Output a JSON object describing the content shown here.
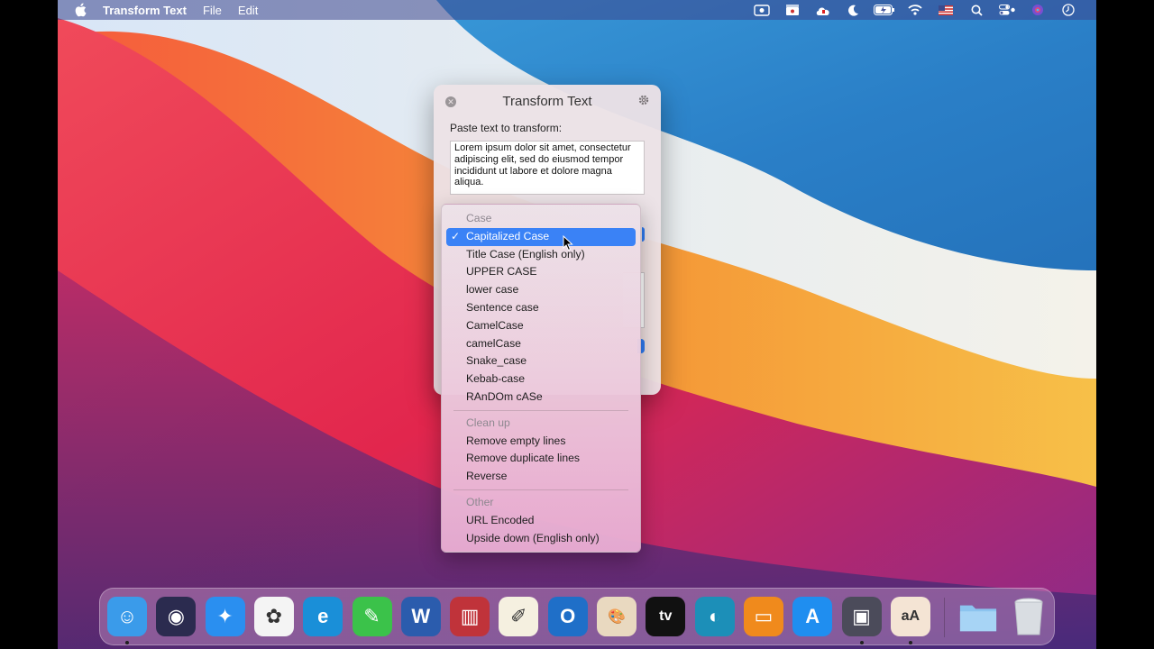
{
  "menubar": {
    "app_name": "Transform Text",
    "menus": [
      "File",
      "Edit"
    ],
    "status_icons": [
      "screen-record-icon",
      "clapper-icon",
      "cloud-icon",
      "moon-icon",
      "battery-icon",
      "wifi-icon",
      "flag-icon",
      "search-icon",
      "control-center-icon",
      "siri-icon",
      "clock-icon"
    ]
  },
  "window": {
    "title": "Transform Text",
    "input_label": "Paste text to transform:",
    "input_text": "Lorem ipsum dolor sit amet, consectetur adipiscing elit, sed do eiusmod tempor incididunt ut labore et dolore magna aliqua."
  },
  "dropdown": {
    "sections": [
      {
        "header": "Case",
        "items": [
          {
            "label": "Capitalized Case",
            "selected": true
          },
          {
            "label": "Title Case (English only)"
          },
          {
            "label": "UPPER CASE"
          },
          {
            "label": "lower case"
          },
          {
            "label": "Sentence case"
          },
          {
            "label": "CamelCase"
          },
          {
            "label": "camelCase"
          },
          {
            "label": "Snake_case"
          },
          {
            "label": "Kebab-case"
          },
          {
            "label": "RAnDOm cASe"
          }
        ]
      },
      {
        "header": "Clean up",
        "items": [
          {
            "label": "Remove empty lines"
          },
          {
            "label": "Remove duplicate lines"
          },
          {
            "label": "Reverse"
          }
        ]
      },
      {
        "header": "Other",
        "items": [
          {
            "label": "URL Encoded"
          },
          {
            "label": "Upside down (English only)"
          }
        ]
      }
    ],
    "check_glyph": "✓"
  },
  "dock": {
    "apps": [
      {
        "name": "finder-icon",
        "color": "#3a9bea",
        "glyph": "☺",
        "running": true
      },
      {
        "name": "siri-icon",
        "color": "#2b2b4f",
        "glyph": "◉",
        "running": false
      },
      {
        "name": "safari-icon",
        "color": "#2a8ff0",
        "glyph": "✦",
        "running": false
      },
      {
        "name": "photos-icon",
        "color": "#f4f4f4",
        "glyph": "✿",
        "running": false
      },
      {
        "name": "internet-explorer-icon",
        "color": "#1a8fd8",
        "glyph": "e",
        "running": false
      },
      {
        "name": "evernote-icon",
        "color": "#3bc24a",
        "glyph": "✎",
        "running": false
      },
      {
        "name": "word-icon",
        "color": "#2b5cad",
        "glyph": "W",
        "running": false
      },
      {
        "name": "parallels-icon",
        "color": "#c0333a",
        "glyph": "▥",
        "running": false
      },
      {
        "name": "textedit-icon",
        "color": "#f5f0e0",
        "glyph": "✐",
        "running": false
      },
      {
        "name": "outlook-icon",
        "color": "#1f6fc8",
        "glyph": "O",
        "running": false
      },
      {
        "name": "paint-icon",
        "color": "#e9d9c0",
        "glyph": "🎨",
        "running": false
      },
      {
        "name": "apple-tv-icon",
        "color": "#111111",
        "glyph": "tv",
        "running": false
      },
      {
        "name": "edge-icon",
        "color": "#1c8fb8",
        "glyph": "◐",
        "running": false
      },
      {
        "name": "books-icon",
        "color": "#f08a1c",
        "glyph": "▭",
        "running": false
      },
      {
        "name": "app-store-icon",
        "color": "#1f8ef0",
        "glyph": "A",
        "running": false
      },
      {
        "name": "media-icon",
        "color": "#4b4b5a",
        "glyph": "▣",
        "running": true
      },
      {
        "name": "transform-text-icon",
        "color": "#f4e4d4",
        "glyph": "aA",
        "running": true
      }
    ],
    "folder": {
      "name": "folder-icon",
      "color": "#8cc4ef"
    },
    "trash": {
      "name": "trash-icon",
      "color": "#d9dde2"
    }
  }
}
